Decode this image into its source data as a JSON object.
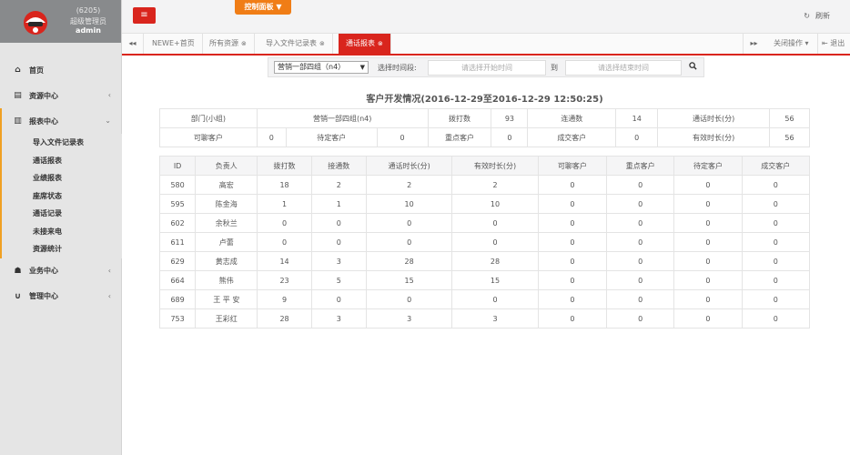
{
  "user": {
    "id": "(6205)",
    "role": "超级管理员",
    "name": "admin"
  },
  "sidebar": {
    "items": [
      {
        "label": "首页",
        "icon": "home-icon",
        "glyph": "⌂"
      },
      {
        "label": "资源中心",
        "icon": "list-icon",
        "glyph": "▤",
        "chevron": "‹"
      },
      {
        "label": "报表中心",
        "icon": "bar-chart-icon",
        "glyph": "▥",
        "chevron": "⌄",
        "subitems": [
          "导入文件记录表",
          "通话报表",
          "业绩报表",
          "座席状态",
          "通话记录",
          "未接来电",
          "资源统计"
        ]
      },
      {
        "label": "业务中心",
        "icon": "graduation-cap-icon",
        "glyph": "☗",
        "chevron": "‹"
      },
      {
        "label": "管理中心",
        "icon": "magnet-icon",
        "glyph": "∪",
        "chevron": "‹"
      }
    ]
  },
  "topbar": {
    "menu_glyph": "≡",
    "control_panel": "控制面板 ▼",
    "refresh_icon": "↻",
    "refresh": "刷新"
  },
  "tabs": {
    "left_arrow": "◂◂",
    "items": [
      {
        "label": "NEWE+首页",
        "closable": false
      },
      {
        "label": "所有资源",
        "closable": true
      },
      {
        "label": "导入文件记录表",
        "closable": true
      },
      {
        "label": "通话报表",
        "closable": true,
        "active": true
      }
    ],
    "close_glyph": "⊗",
    "right_arrow": "▸▸",
    "close_ops": "关闭操作 ▾",
    "logout": "⇤ 退出"
  },
  "filter": {
    "group_selected": "营销一部四组（n4）",
    "select_arrow": "▼",
    "time_label": "选择时间段:",
    "start_placeholder": "请选择开始时间",
    "to_label": "到",
    "end_placeholder": "请选择结束时间",
    "search_glyph": "🔍"
  },
  "report": {
    "title": "客户开发情况(2016-12-29至2016-12-29 12:50:25)",
    "summary_row1": {
      "dept_label": "部门(小组)",
      "dept_value": "营销一部四组(n4)",
      "dial_label": "拨打数",
      "dial_value": "93",
      "conn_label": "连通数",
      "conn_value": "14",
      "talk_label": "通话时长(分)",
      "talk_value": "56"
    },
    "summary_row2": {
      "potential_label": "可聊客户",
      "potential_value": "0",
      "pending_label": "待定客户",
      "pending_value": "0",
      "key_label": "重点客户",
      "key_value": "0",
      "deal_label": "成交客户",
      "deal_value": "0",
      "effective_label": "有效时长(分)",
      "effective_value": "56"
    },
    "columns": [
      "ID",
      "负责人",
      "拨打数",
      "接通数",
      "通话时长(分)",
      "有效时长(分)",
      "可聊客户",
      "重点客户",
      "待定客户",
      "成交客户"
    ],
    "rows": [
      [
        "580",
        "高宏",
        "18",
        "2",
        "2",
        "2",
        "0",
        "0",
        "0",
        "0"
      ],
      [
        "595",
        "陈金海",
        "1",
        "1",
        "10",
        "10",
        "0",
        "0",
        "0",
        "0"
      ],
      [
        "602",
        "余秋兰",
        "0",
        "0",
        "0",
        "0",
        "0",
        "0",
        "0",
        "0"
      ],
      [
        "611",
        "卢蕾",
        "0",
        "0",
        "0",
        "0",
        "0",
        "0",
        "0",
        "0"
      ],
      [
        "629",
        "黄志成",
        "14",
        "3",
        "28",
        "28",
        "0",
        "0",
        "0",
        "0"
      ],
      [
        "664",
        "熊伟",
        "23",
        "5",
        "15",
        "15",
        "0",
        "0",
        "0",
        "0"
      ],
      [
        "689",
        "王 平 安",
        "9",
        "0",
        "0",
        "0",
        "0",
        "0",
        "0",
        "0"
      ],
      [
        "753",
        "王彩红",
        "28",
        "3",
        "3",
        "3",
        "0",
        "0",
        "0",
        "0"
      ]
    ]
  }
}
